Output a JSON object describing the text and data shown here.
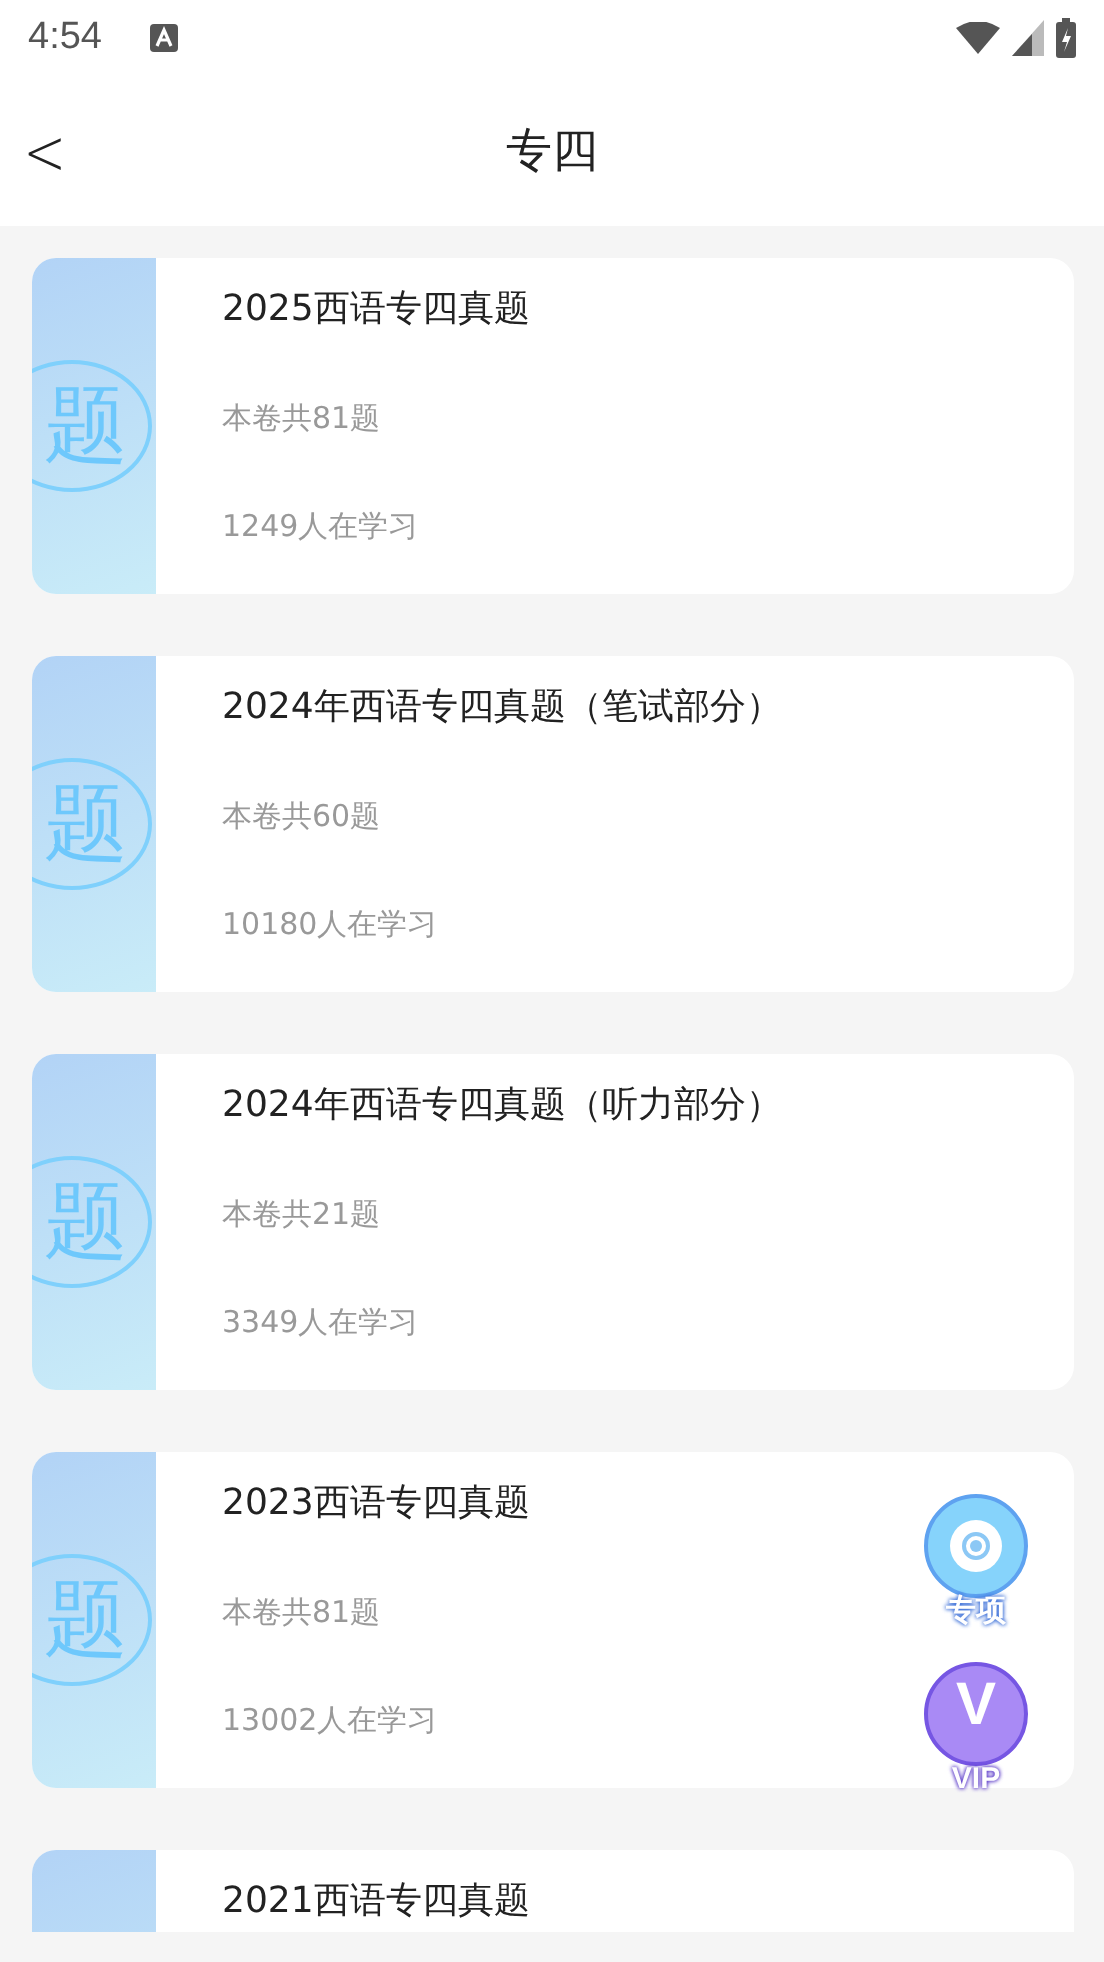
{
  "status_bar": {
    "time": "4:54"
  },
  "header": {
    "back": "<",
    "title": "专四"
  },
  "papers": [
    {
      "cover_text": "题",
      "title": "2025西语专四真题",
      "question_count": "本卷共81题",
      "learners": "1249人在学习"
    },
    {
      "cover_text": "题",
      "title": "2024年西语专四真题（笔试部分）",
      "question_count": "本卷共60题",
      "learners": "10180人在学习"
    },
    {
      "cover_text": "题",
      "title": "2024年西语专四真题（听力部分）",
      "question_count": "本卷共21题",
      "learners": "3349人在学习"
    },
    {
      "cover_text": "题",
      "title": "2023西语专四真题",
      "question_count": "本卷共81题",
      "learners": "13002人在学习"
    },
    {
      "title": "2021西语专四真题"
    }
  ],
  "floating_buttons": [
    {
      "kind": "special",
      "label": "专项"
    },
    {
      "kind": "vip",
      "label": "VIP",
      "glyph": "V"
    }
  ]
}
